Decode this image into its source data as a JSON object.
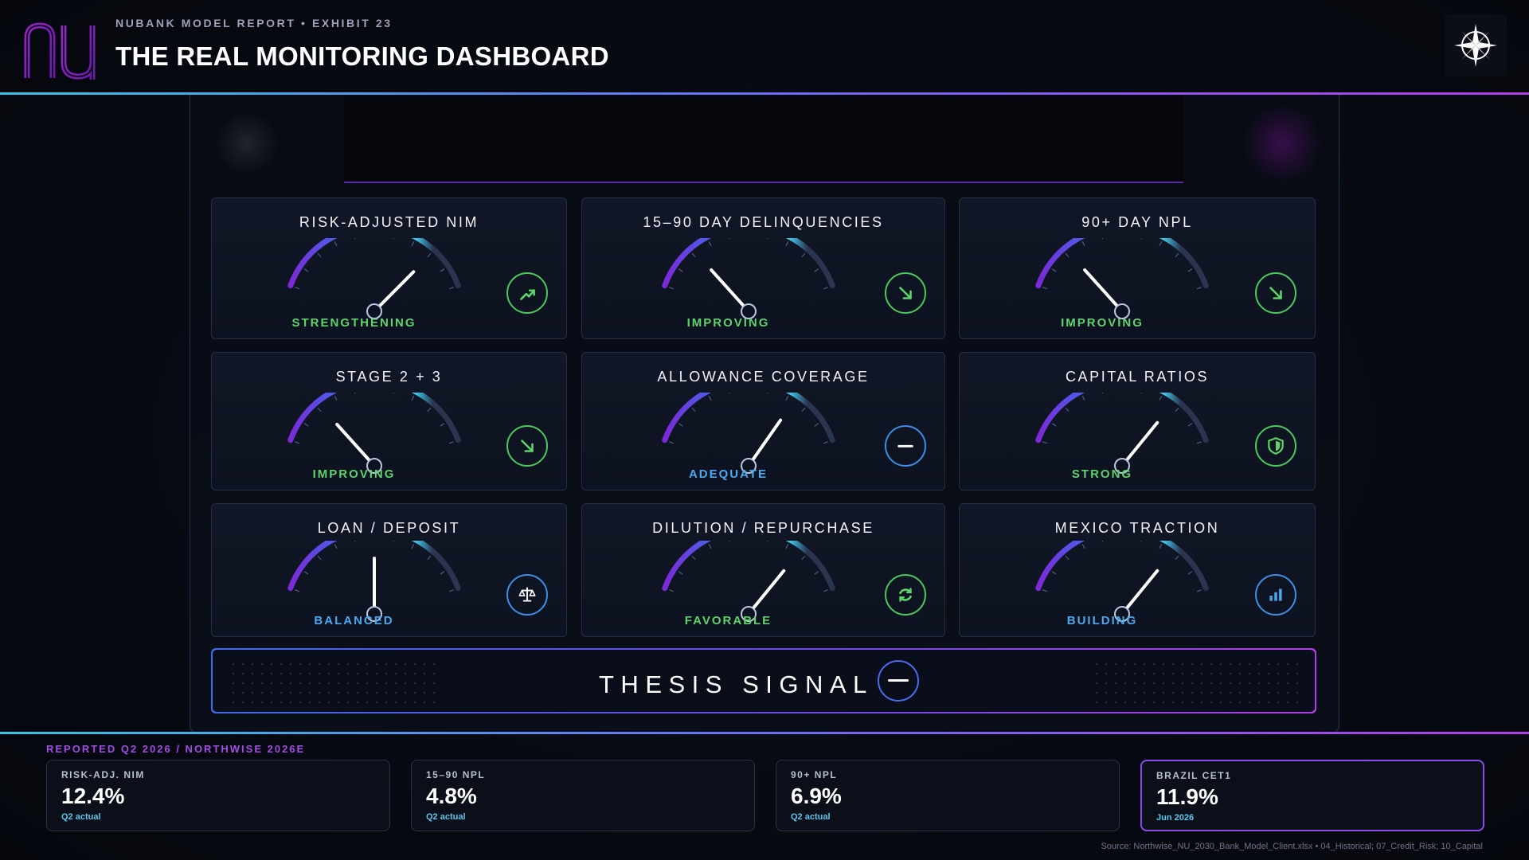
{
  "header": {
    "eyebrow": "NUBANK MODEL REPORT • EXHIBIT 23",
    "title": "THE REAL MONITORING DASHBOARD",
    "logo_text": "nu",
    "accent_purple": "#8a2be2",
    "accent_cyan": "#36c3e6"
  },
  "gauges": [
    {
      "title": "RISK-ADJUSTED NIM",
      "status": "STRENGTHENING",
      "status_color": "green",
      "trend_icon": "trend-up-icon",
      "needle_level": 0.82
    },
    {
      "title": "15–90 DAY DELINQUENCIES",
      "status": "IMPROVING",
      "status_color": "green",
      "trend_icon": "trend-down-icon",
      "needle_level": 0.2
    },
    {
      "title": "90+ DAY NPL",
      "status": "IMPROVING",
      "status_color": "green",
      "trend_icon": "trend-down-icon",
      "needle_level": 0.2
    },
    {
      "title": "STAGE 2 + 3",
      "status": "IMPROVING",
      "status_color": "green",
      "trend_icon": "trend-down-icon",
      "needle_level": 0.2
    },
    {
      "title": "ALLOWANCE COVERAGE",
      "status": "ADEQUATE",
      "status_color": "blue",
      "trend_icon": "neutral-icon",
      "needle_level": 0.75
    },
    {
      "title": "CAPITAL RATIOS",
      "status": "STRONG",
      "status_color": "green",
      "trend_icon": "shield-icon",
      "needle_level": 0.78
    },
    {
      "title": "LOAN / DEPOSIT",
      "status": "BALANCED",
      "status_color": "blue",
      "trend_icon": "scale-icon",
      "needle_level": 0.5
    },
    {
      "title": "DILUTION / REPURCHASE",
      "status": "FAVORABLE",
      "status_color": "green",
      "trend_icon": "refresh-icon",
      "needle_level": 0.78
    },
    {
      "title": "MEXICO TRACTION",
      "status": "BUILDING",
      "status_color": "blue",
      "trend_icon": "bar-chart-icon",
      "needle_level": 0.78
    }
  ],
  "thesis": {
    "label": "THESIS SIGNAL",
    "icon": "neutral-icon"
  },
  "bottom": {
    "reported_label": "REPORTED Q2 2026 / NORTHWISE 2026E",
    "kpis": [
      {
        "label": "RISK-ADJ. NIM",
        "value": "12.4%",
        "sub": "Q2 actual"
      },
      {
        "label": "15–90 NPL",
        "value": "4.8%",
        "sub": "Q2 actual"
      },
      {
        "label": "90+ NPL",
        "value": "6.9%",
        "sub": "Q2 actual"
      },
      {
        "label": "BRAZIL CET1",
        "value": "11.9%",
        "sub": "Jun 2026"
      }
    ],
    "source": "Source: Northwise_NU_2030_Bank_Model_Client.xlsx • 04_Historical; 07_Credit_Risk; 10_Capital"
  },
  "colors": {
    "green": "#5fd36a",
    "blue": "#4aa9f0",
    "purple": "#a54be8"
  }
}
